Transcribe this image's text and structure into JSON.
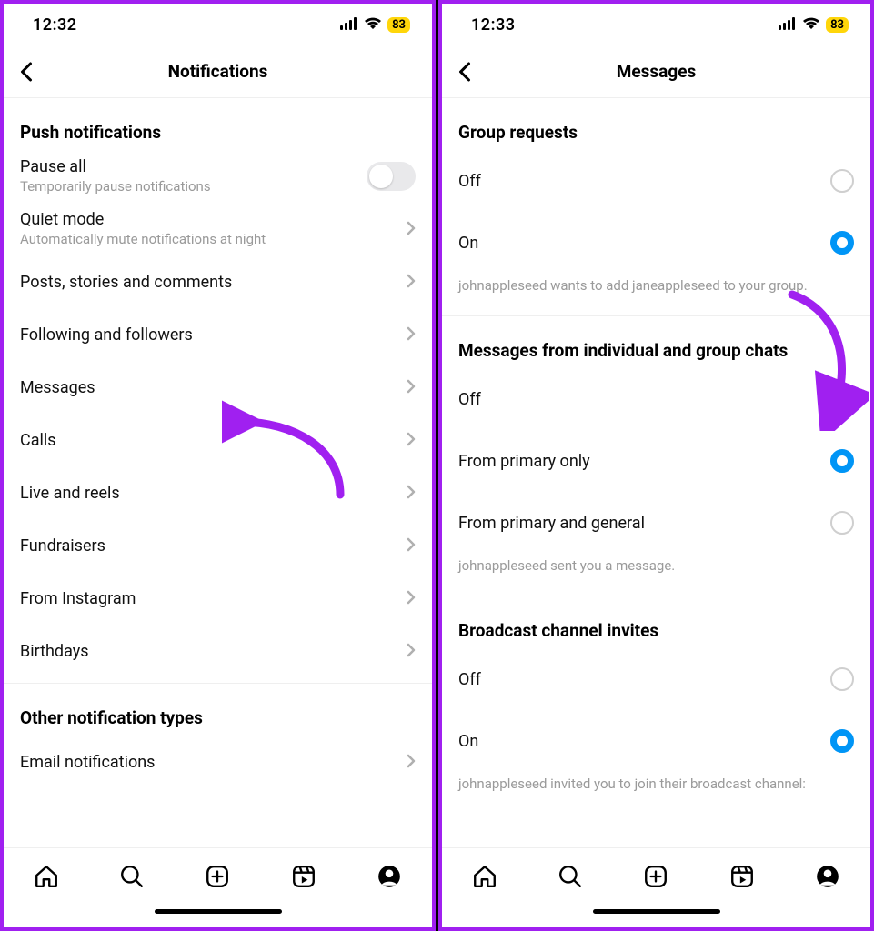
{
  "left": {
    "status": {
      "time": "12:32",
      "battery": "83"
    },
    "title": "Notifications",
    "section1_title": "Push notifications",
    "pause_all": {
      "label": "Pause all",
      "sub": "Temporarily pause notifications"
    },
    "quiet_mode": {
      "label": "Quiet mode",
      "sub": "Automatically mute notifications at night"
    },
    "items": [
      {
        "label": "Posts, stories and comments"
      },
      {
        "label": "Following and followers"
      },
      {
        "label": "Messages"
      },
      {
        "label": "Calls"
      },
      {
        "label": "Live and reels"
      },
      {
        "label": "Fundraisers"
      },
      {
        "label": "From Instagram"
      },
      {
        "label": "Birthdays"
      }
    ],
    "section2_title": "Other notification types",
    "email": {
      "label": "Email notifications"
    }
  },
  "right": {
    "status": {
      "time": "12:33",
      "battery": "83"
    },
    "title": "Messages",
    "group1_title": "Group requests",
    "group1_off": "Off",
    "group1_on": "On",
    "group1_example": "johnappleseed wants to add janeappleseed to your group.",
    "group2_title": "Messages from individual and group chats",
    "group2_off": "Off",
    "group2_primary": "From primary only",
    "group2_both": "From primary and general",
    "group2_example": "johnappleseed sent you a message.",
    "group3_title": "Broadcast channel invites",
    "group3_off": "Off",
    "group3_on": "On",
    "group3_example": "johnappleseed invited you to join their broadcast channel:"
  }
}
